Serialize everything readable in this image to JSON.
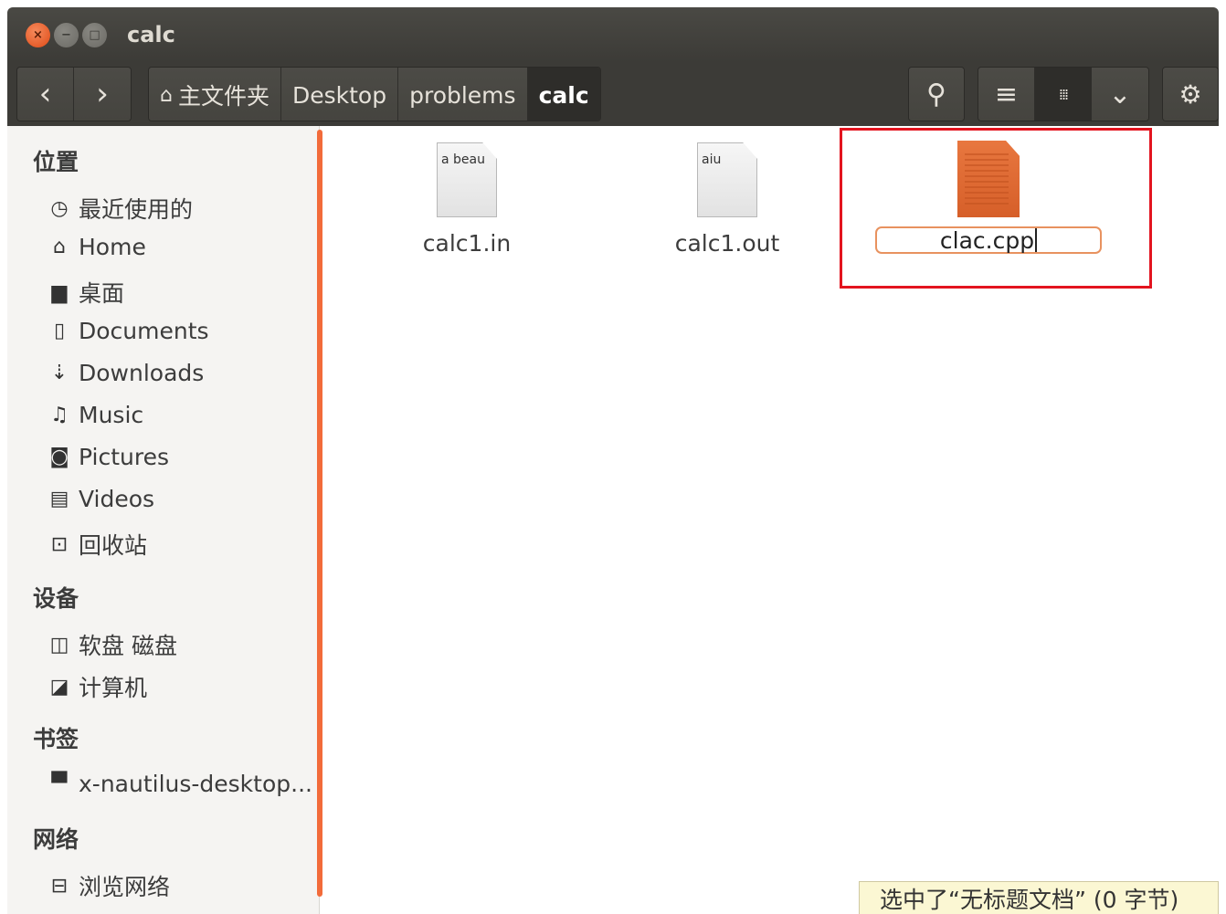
{
  "window": {
    "title": "calc",
    "close_glyph": "×",
    "minimize_glyph": "−",
    "maximize_glyph": "□"
  },
  "toolbar": {
    "back_icon": "chevron-left-icon",
    "forward_icon": "chevron-right-icon",
    "back_glyph": "‹",
    "forward_glyph": "›",
    "breadcrumbs": [
      {
        "label": "主文件夹",
        "icon": "home-icon"
      },
      {
        "label": "Desktop"
      },
      {
        "label": "problems"
      },
      {
        "label": "calc",
        "current": true
      }
    ],
    "search_glyph": "⚲",
    "list_view_glyph": "≡",
    "grid_view_glyph": "⁞⁞⁞",
    "view_options_glyph": "⌄",
    "settings_glyph": "⚙"
  },
  "sidebar": {
    "sections": [
      {
        "heading": "位置",
        "items": [
          {
            "label": "最近使用的",
            "icon": "clock-icon",
            "glyph": "◷"
          },
          {
            "label": "Home",
            "icon": "home-icon",
            "glyph": "⌂"
          },
          {
            "label": "桌面",
            "icon": "folder-icon",
            "glyph": "▆"
          },
          {
            "label": "Documents",
            "icon": "document-icon",
            "glyph": "▯"
          },
          {
            "label": "Downloads",
            "icon": "download-icon",
            "glyph": "⇣"
          },
          {
            "label": "Music",
            "icon": "music-icon",
            "glyph": "♫"
          },
          {
            "label": "Pictures",
            "icon": "camera-icon",
            "glyph": "◙"
          },
          {
            "label": "Videos",
            "icon": "film-icon",
            "glyph": "▤"
          },
          {
            "label": "回收站",
            "icon": "trash-icon",
            "glyph": "⊡"
          }
        ]
      },
      {
        "heading": "设备",
        "items": [
          {
            "label": "软盘 磁盘",
            "icon": "floppy-icon",
            "glyph": "◫"
          },
          {
            "label": "计算机",
            "icon": "computer-icon",
            "glyph": "◪"
          }
        ]
      },
      {
        "heading": "书签",
        "items": [
          {
            "label": "x-nautilus-desktop...",
            "icon": "desktop-icon",
            "glyph": "▀"
          }
        ]
      },
      {
        "heading": "网络",
        "items": [
          {
            "label": "浏览网络",
            "icon": "network-icon",
            "glyph": "⊟"
          }
        ]
      }
    ]
  },
  "files": [
    {
      "name": "calc1.in",
      "icon": "text-file-icon",
      "preview": "a beau"
    },
    {
      "name": "calc1.out",
      "icon": "text-file-icon",
      "preview": "aiu"
    },
    {
      "name": "clac.cpp",
      "icon": "cpp-file-icon",
      "renaming": true
    }
  ],
  "status": {
    "text": "选中了“无标题文档” (0 字节)"
  },
  "colors": {
    "accent": "#f26b3a",
    "highlight": "#e3141f",
    "toolbar": "#3c3b37"
  }
}
